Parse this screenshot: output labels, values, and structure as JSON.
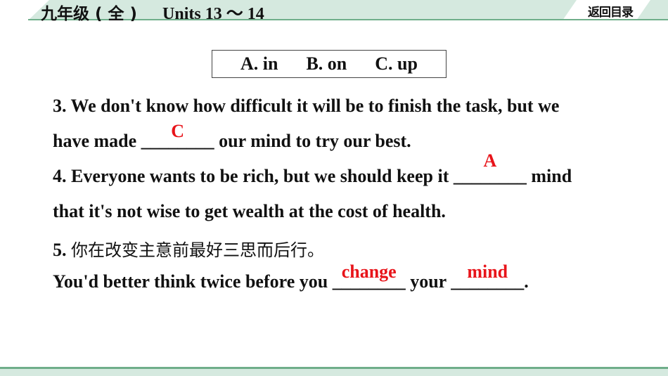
{
  "header": {
    "grade": "九年级 ( 全 )",
    "units": "Units 13 ～ 14",
    "back_label": "返回目录"
  },
  "options": [
    "A. in",
    "B. on",
    "C. up"
  ],
  "questions": {
    "q3": {
      "line1": "3. We don't know how difficult it will be to finish the task, but we",
      "line2_pre": "have made ",
      "blank": "________",
      "answer": "C",
      "line2_post": " our mind to try our best."
    },
    "q4": {
      "line1_pre": "4. Everyone wants to be rich, but we should keep it ",
      "blank": "________",
      "answer": "A",
      "line1_post": " mind",
      "line2": "that it's not wise to get wealth at the cost of health."
    },
    "q5": {
      "num": "5.  ",
      "chinese": "你在改变主意前最好三思而后行。",
      "line2_pre": "You'd better think twice before you ",
      "blank1": "________",
      "answer1": "change",
      "mid": " your ",
      "blank2": "________",
      "answer2": "mind",
      "end": "."
    }
  },
  "colors": {
    "answer": "#e8141a",
    "band": "#d5e9df",
    "band_line": "#6fae8a"
  }
}
